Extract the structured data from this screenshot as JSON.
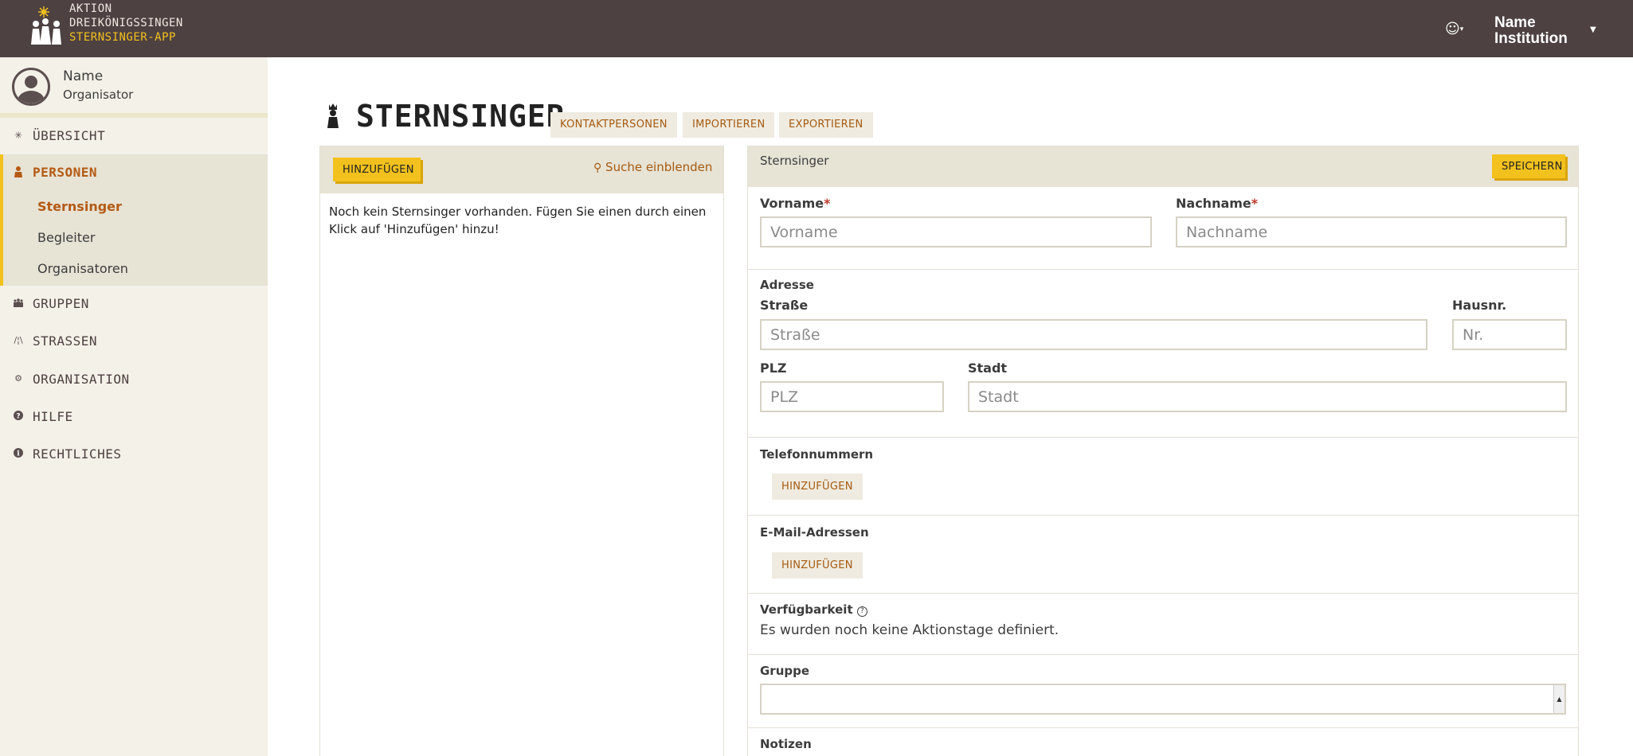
{
  "app": {
    "logo_line1": "AKTION",
    "logo_line2": "DREIKÖNIGSSINGEN",
    "logo_line3": "STERNSINGER-APP",
    "institution_line1": "Name",
    "institution_line2": "Institution"
  },
  "user": {
    "name": "Name",
    "role": "Organisator"
  },
  "sidebar": {
    "items": [
      {
        "label": "ÜBERSICHT",
        "icon": "sun-icon"
      },
      {
        "label": "PERSONEN",
        "icon": "person-icon",
        "active": true
      },
      {
        "label": "GRUPPEN",
        "icon": "group-icon"
      },
      {
        "label": "STRASSEN",
        "icon": "road-icon"
      },
      {
        "label": "ORGANISATION",
        "icon": "organisation-icon"
      },
      {
        "label": "HILFE",
        "icon": "help-icon"
      },
      {
        "label": "RECHTLICHES",
        "icon": "info-icon"
      }
    ],
    "sub_items": [
      {
        "label": "Sternsinger",
        "active": true
      },
      {
        "label": "Begleiter"
      },
      {
        "label": "Organisatoren"
      }
    ]
  },
  "page": {
    "title": "STERNSINGER",
    "buttons": {
      "contacts": "KONTAKTPERSONEN",
      "import": "IMPORTIEREN",
      "export": "EXPORTIEREN"
    }
  },
  "list_panel": {
    "add_label": "HINZUFÜGEN",
    "search_toggle": "Suche einblenden",
    "empty_text": "Noch kein Sternsinger vorhanden. Fügen Sie einen durch einen Klick auf 'Hinzufügen' hinzu!"
  },
  "form": {
    "title": "Sternsinger",
    "save_label": "SPEICHERN",
    "first_name": {
      "label": "Vorname",
      "required_mark": "*",
      "placeholder": "Vorname"
    },
    "last_name": {
      "label": "Nachname",
      "required_mark": "*",
      "placeholder": "Nachname"
    },
    "address_label": "Adresse",
    "street": {
      "label": "Straße",
      "placeholder": "Straße"
    },
    "house_no": {
      "label": "Hausnr.",
      "placeholder": "Nr."
    },
    "zip": {
      "label": "PLZ",
      "placeholder": "PLZ"
    },
    "city": {
      "label": "Stadt",
      "placeholder": "Stadt"
    },
    "phones": {
      "label": "Telefonnummern",
      "add_label": "HINZUFÜGEN"
    },
    "emails": {
      "label": "E-Mail-Adressen",
      "add_label": "HINZUFÜGEN"
    },
    "availability": {
      "label": "Verfügbarkeit",
      "help_icon": "?",
      "text": "Es wurden noch keine Aktionstage definiert."
    },
    "group": {
      "label": "Gruppe",
      "value": ""
    },
    "notes": {
      "label": "Notizen"
    }
  },
  "colors": {
    "topbar": "#4d4141",
    "sidebar_bg": "#f4f1e8",
    "accent_yellow": "#f2c11d",
    "accent_orange": "#b45a14",
    "panel_head": "#e7e3d5"
  }
}
